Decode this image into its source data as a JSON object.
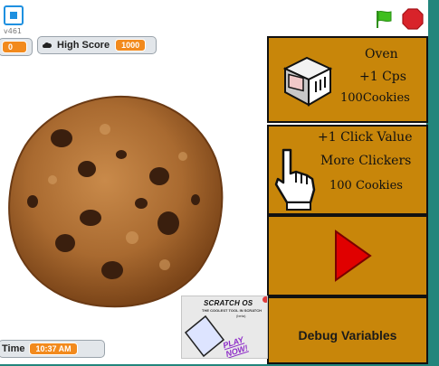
{
  "app": {
    "version": "v461"
  },
  "monitors": {
    "score": {
      "value": "0"
    },
    "high_score": {
      "label": "High Score",
      "value": "1000"
    },
    "time": {
      "label": "Time",
      "value": "10:37 AM"
    }
  },
  "shop": {
    "oven": {
      "name": "Oven",
      "effect": "+1 Cps",
      "cost": "100Cookies"
    },
    "clicker": {
      "effect": "+1 Click Value",
      "name": "More Clickers",
      "cost": "100 Cookies"
    },
    "debug": {
      "label": "Debug Variables"
    }
  },
  "ad": {
    "title": "SCRATCH OS",
    "tagline": "THE COOLEST TOOL IN SCRATCH",
    "tagline2": "(beta)",
    "cta": "PLAY NOW!"
  },
  "colors": {
    "accent_orange": "#f28a1d",
    "panel_brown": "#c8860a",
    "frame_teal": "#22857c",
    "play_red": "#e00000"
  },
  "icons": {
    "fullscreen": "fullscreen-icon",
    "flag": "green-flag-icon",
    "stop": "stop-icon",
    "cloud": "cloud-icon",
    "oven": "oven-icon",
    "hand": "pointer-hand-icon",
    "play": "play-triangle-icon"
  }
}
